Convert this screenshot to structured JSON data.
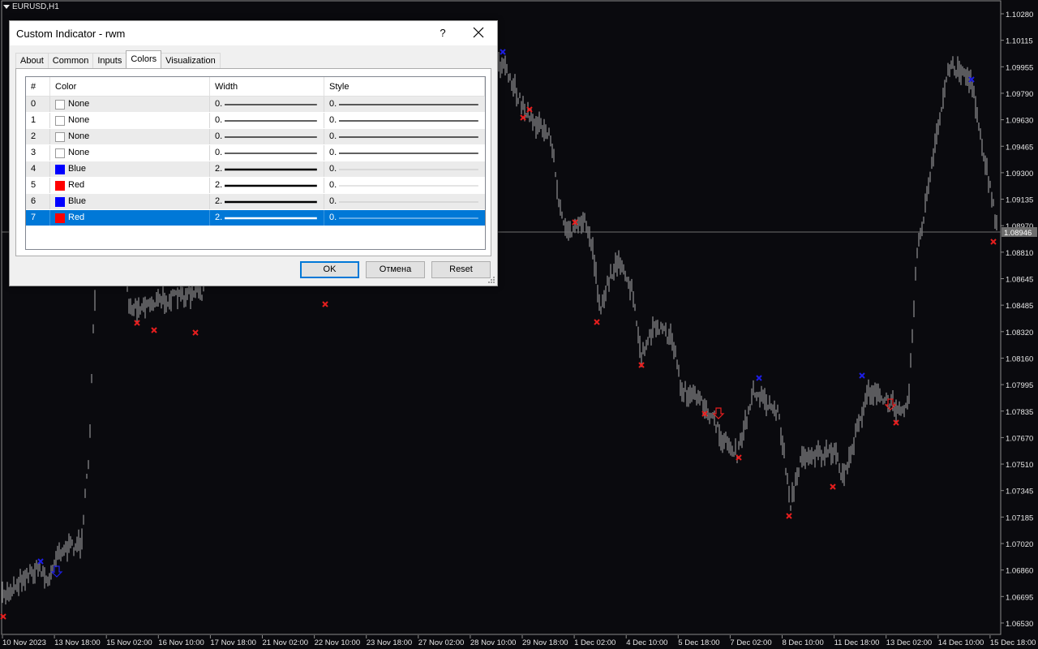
{
  "chart": {
    "symbol": "EURUSD,H1",
    "current_price": "1.08946",
    "price_ticks": [
      "1.10280",
      "1.10115",
      "1.09955",
      "1.09790",
      "1.09630",
      "1.09465",
      "1.09300",
      "1.09135",
      "1.08970",
      "1.08810",
      "1.08645",
      "1.08485",
      "1.08320",
      "1.08160",
      "1.07995",
      "1.07835",
      "1.07670",
      "1.07510",
      "1.07345",
      "1.07185",
      "1.07020",
      "1.06860",
      "1.06695",
      "1.06530"
    ],
    "time_ticks": [
      "10 Nov 2023",
      "13 Nov 18:00",
      "15 Nov 02:00",
      "16 Nov 10:00",
      "17 Nov 18:00",
      "21 Nov 02:00",
      "22 Nov 10:00",
      "23 Nov 18:00",
      "27 Nov 02:00",
      "28 Nov 10:00",
      "29 Nov 18:00",
      "1 Dec 02:00",
      "4 Dec 10:00",
      "5 Dec 18:00",
      "7 Dec 02:00",
      "8 Dec 10:00",
      "11 Dec 18:00",
      "13 Dec 02:00",
      "14 Dec 10:00",
      "15 Dec 18:00"
    ],
    "colors": {
      "background": "#0a0a0e",
      "bars": "#c8c8c8",
      "axis_text": "#e6e6e6",
      "buy": "#1e1ee6",
      "sell": "#e61e1e"
    }
  },
  "dialog": {
    "title": "Custom Indicator - rwm",
    "help_label": "?",
    "tabs": [
      {
        "label": "About",
        "active": false
      },
      {
        "label": "Common",
        "active": false
      },
      {
        "label": "Inputs",
        "active": false
      },
      {
        "label": "Colors",
        "active": true
      },
      {
        "label": "Visualization",
        "active": false
      }
    ],
    "columns": {
      "index": "#",
      "color": "Color",
      "width": "Width",
      "style": "Style"
    },
    "rows": [
      {
        "index": "0",
        "color_name": "None",
        "color_hex": "#ffffff",
        "width": "0.",
        "style": "0.",
        "width_weight": 1,
        "style_weight": 1
      },
      {
        "index": "1",
        "color_name": "None",
        "color_hex": "#ffffff",
        "width": "0.",
        "style": "0.",
        "width_weight": 1,
        "style_weight": 1
      },
      {
        "index": "2",
        "color_name": "None",
        "color_hex": "#ffffff",
        "width": "0.",
        "style": "0.",
        "width_weight": 1,
        "style_weight": 1
      },
      {
        "index": "3",
        "color_name": "None",
        "color_hex": "#ffffff",
        "width": "0.",
        "style": "0.",
        "width_weight": 1,
        "style_weight": 1
      },
      {
        "index": "4",
        "color_name": "Blue",
        "color_hex": "#0000ff",
        "width": "2.",
        "style": "0.",
        "width_weight": 2,
        "style_weight": 0
      },
      {
        "index": "5",
        "color_name": "Red",
        "color_hex": "#ff0000",
        "width": "2.",
        "style": "0.",
        "width_weight": 2,
        "style_weight": 0
      },
      {
        "index": "6",
        "color_name": "Blue",
        "color_hex": "#0000ff",
        "width": "2.",
        "style": "0.",
        "width_weight": 2,
        "style_weight": 0
      },
      {
        "index": "7",
        "color_name": "Red",
        "color_hex": "#ff0000",
        "width": "2.",
        "style": "0.",
        "width_weight": 2,
        "style_weight": 0,
        "selected": true
      }
    ],
    "buttons": {
      "ok": "OK",
      "cancel": "Отмена",
      "reset": "Reset"
    }
  }
}
